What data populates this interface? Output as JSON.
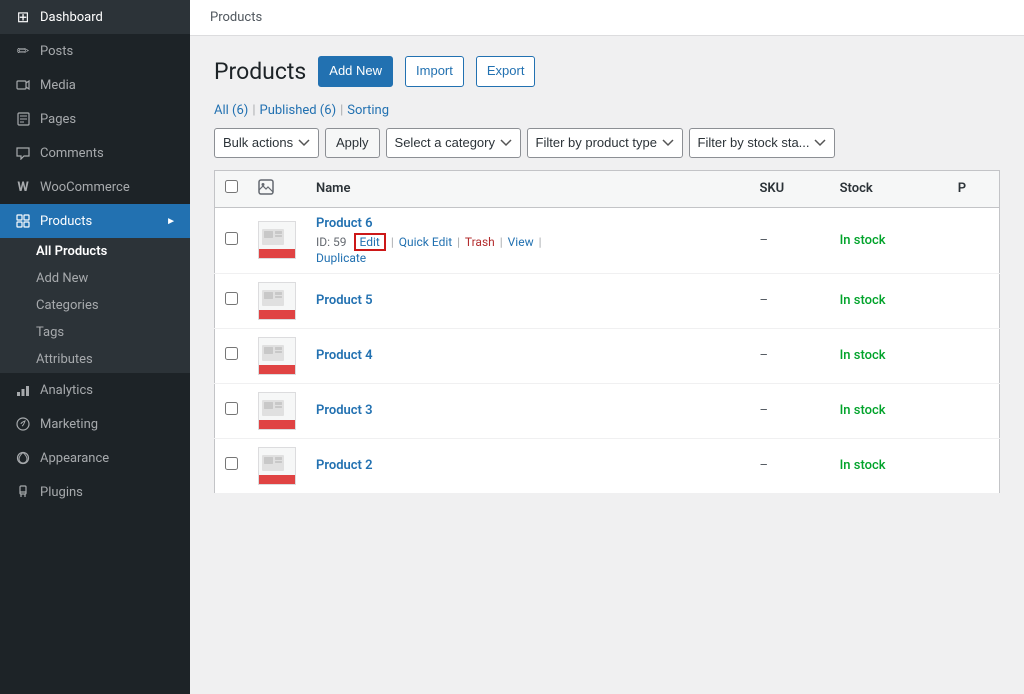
{
  "topbar": {
    "breadcrumb": "Products"
  },
  "sidebar": {
    "items": [
      {
        "id": "dashboard",
        "label": "Dashboard",
        "icon": "⊞"
      },
      {
        "id": "posts",
        "label": "Posts",
        "icon": "✎"
      },
      {
        "id": "media",
        "label": "Media",
        "icon": "🎞"
      },
      {
        "id": "pages",
        "label": "Pages",
        "icon": "📄"
      },
      {
        "id": "comments",
        "label": "Comments",
        "icon": "💬"
      },
      {
        "id": "woocommerce",
        "label": "WooCommerce",
        "icon": "Ⓦ"
      },
      {
        "id": "products",
        "label": "Products",
        "icon": "🏷",
        "active": true
      },
      {
        "id": "analytics",
        "label": "Analytics",
        "icon": "📊"
      },
      {
        "id": "marketing",
        "label": "Marketing",
        "icon": "📣"
      },
      {
        "id": "appearance",
        "label": "Appearance",
        "icon": "🎨"
      },
      {
        "id": "plugins",
        "label": "Plugins",
        "icon": "🔌"
      }
    ],
    "submenu": {
      "products": [
        {
          "id": "all-products",
          "label": "All Products",
          "active": true
        },
        {
          "id": "add-new",
          "label": "Add New"
        },
        {
          "id": "categories",
          "label": "Categories"
        },
        {
          "id": "tags",
          "label": "Tags"
        },
        {
          "id": "attributes",
          "label": "Attributes"
        }
      ]
    }
  },
  "page": {
    "title": "Products",
    "breadcrumb": "Products",
    "buttons": {
      "add_new": "Add New",
      "import": "Import",
      "export": "Export"
    },
    "view_links": {
      "all": "All (6)",
      "published": "Published (6)",
      "sorting": "Sorting"
    },
    "filter": {
      "bulk_actions_label": "Bulk actions",
      "apply_label": "Apply",
      "category_placeholder": "Select a category",
      "product_type_placeholder": "Filter by product type",
      "stock_placeholder": "Filter by stock sta..."
    },
    "table": {
      "headers": [
        "",
        "",
        "Name",
        "SKU",
        "Stock",
        "P"
      ],
      "rows": [
        {
          "id": 6,
          "name": "Product 6",
          "product_id": "ID: 59",
          "sku": "–",
          "stock": "In stock",
          "show_actions": true
        },
        {
          "id": 5,
          "name": "Product 5",
          "product_id": "",
          "sku": "–",
          "stock": "In stock",
          "show_actions": false
        },
        {
          "id": 4,
          "name": "Product 4",
          "product_id": "",
          "sku": "–",
          "stock": "In stock",
          "show_actions": false
        },
        {
          "id": 3,
          "name": "Product 3",
          "product_id": "",
          "sku": "–",
          "stock": "In stock",
          "show_actions": false
        },
        {
          "id": 2,
          "name": "Product 2",
          "product_id": "",
          "sku": "–",
          "stock": "In stock",
          "show_actions": false
        }
      ],
      "actions": {
        "edit": "Edit",
        "quick_edit": "Quick Edit",
        "trash": "Trash",
        "view": "View",
        "duplicate": "Duplicate"
      }
    }
  }
}
